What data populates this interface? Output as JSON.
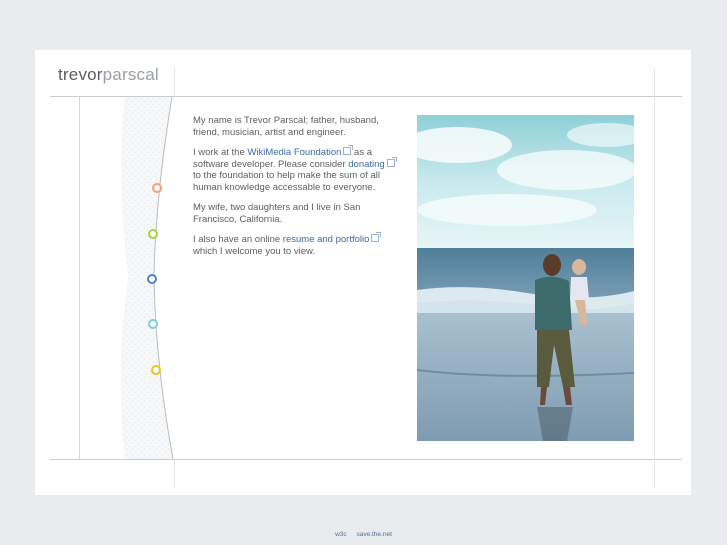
{
  "logo": {
    "part1": "trevor",
    "part2": "parscal"
  },
  "content": {
    "p1": "My name is Trevor Parscal; father, husband, friend, musician, artist and engineer.",
    "p2_before": "I work at the ",
    "p2_link1": "WikiMedia Foundation",
    "p2_mid1": " as a software developer. Please consider ",
    "p2_link2": "donating",
    "p2_after": " to the foundation to help make the sum of all human knowledge accessable to everyone.",
    "p3": "My wife, two daughters and I live in San Francisco, California.",
    "p4_before": "I also have an online ",
    "p4_link": "resume and portfolio",
    "p4_after": " which I welcome you to view."
  },
  "nav_dots": [
    {
      "color": "#f0a070",
      "icon": "orange-circle"
    },
    {
      "color": "#a8d23a",
      "icon": "green-circle"
    },
    {
      "color": "#4a86c6",
      "icon": "blue-circle"
    },
    {
      "color": "#7ad0dc",
      "icon": "cyan-circle"
    },
    {
      "color": "#f2c21a",
      "icon": "yellow-circle"
    }
  ],
  "footer": {
    "link1": "w3c",
    "link2": "save.the.net"
  },
  "colors": {
    "link": "#3b6aa3",
    "text": "#5b5f63",
    "background": "#e9ecee"
  }
}
